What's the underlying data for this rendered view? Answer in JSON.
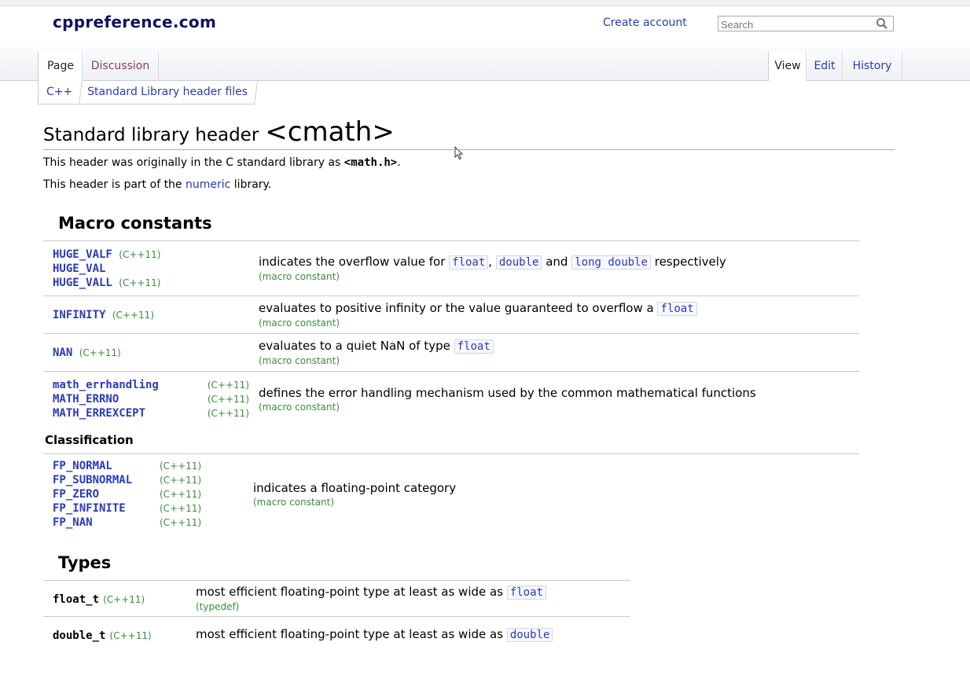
{
  "header": {
    "site_name": "cppreference.com",
    "create_account": "Create account",
    "search_placeholder": "Search"
  },
  "tabs": {
    "page": "Page",
    "discussion": "Discussion",
    "view": "View",
    "edit": "Edit",
    "history": "History"
  },
  "breadcrumb": {
    "root": "C++",
    "current": "Standard Library header files"
  },
  "page": {
    "title_prefix": "Standard library header",
    "title_header": "<cmath>",
    "intro1_prefix": "This header was originally in the C standard library as",
    "intro1_code": "<math.h>",
    "intro1_suffix": ".",
    "intro2_prefix": "This header is part of the",
    "intro2_link": "numeric",
    "intro2_suffix": "library."
  },
  "sections": {
    "macro_constants": "Macro constants",
    "classification": "Classification",
    "types": "Types"
  },
  "macro_rows": [
    {
      "names": [
        [
          "HUGE_VALF",
          "(C++11)"
        ],
        [
          "HUGE_VAL",
          ""
        ],
        [
          "HUGE_VALL",
          "(C++11)"
        ]
      ],
      "desc_parts": [
        "indicates the overflow value for",
        "float",
        ",",
        "double",
        "and",
        "long double",
        "respectively"
      ],
      "mark": "(macro constant)"
    },
    {
      "names": [
        [
          "INFINITY",
          "(C++11)"
        ]
      ],
      "desc_text": "evaluates to positive infinity or the value guaranteed to overflow a",
      "desc_kw": "float",
      "mark": "(macro constant)"
    },
    {
      "names": [
        [
          "NAN",
          "(C++11)"
        ]
      ],
      "desc_text": "evaluates to a quiet NaN of type",
      "desc_kw": "float",
      "mark": "(macro constant)"
    },
    {
      "names": [
        [
          "math_errhandling",
          "(C++11)"
        ],
        [
          "MATH_ERRNO",
          "(C++11)"
        ],
        [
          "MATH_ERREXCEPT",
          "(C++11)"
        ]
      ],
      "desc_text": "defines the error handling mechanism used by the common mathematical functions",
      "mark": "(macro constant)"
    }
  ],
  "classification_row": {
    "names": [
      [
        "FP_NORMAL",
        "(C++11)"
      ],
      [
        "FP_SUBNORMAL",
        "(C++11)"
      ],
      [
        "FP_ZERO",
        "(C++11)"
      ],
      [
        "FP_INFINITE",
        "(C++11)"
      ],
      [
        "FP_NAN",
        "(C++11)"
      ]
    ],
    "desc_text": "indicates a floating-point category",
    "mark": "(macro constant)"
  },
  "types_rows": [
    {
      "name": "float_t",
      "ver": "(C++11)",
      "desc_text": "most efficient floating-point type at least as wide as",
      "desc_kw": "float",
      "mark": "(typedef)"
    },
    {
      "name": "double_t",
      "ver": "(C++11)",
      "desc_text": "most efficient floating-point type at least as wide as",
      "desc_kw": "double",
      "mark": ""
    }
  ]
}
